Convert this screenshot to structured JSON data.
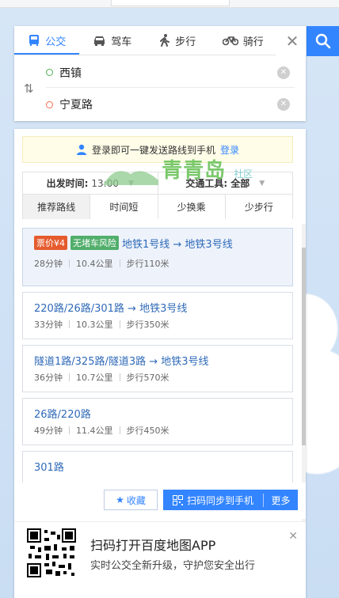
{
  "modes": [
    {
      "label": "公交",
      "icon": "bus-icon",
      "active": true
    },
    {
      "label": "驾车",
      "icon": "car-icon",
      "active": false
    },
    {
      "label": "步行",
      "icon": "walk-icon",
      "active": false
    },
    {
      "label": "骑行",
      "icon": "bike-icon",
      "active": false
    }
  ],
  "route": {
    "start": "西镇",
    "end": "宁夏路"
  },
  "login_tip": {
    "text": "登录即可一键发送路线到手机",
    "link": "登录"
  },
  "filters": {
    "depart_label": "出发时间:",
    "depart_value": "13:00",
    "transport_label": "交通工具:",
    "transport_value": "全部",
    "prefs": [
      "推荐路线",
      "时间短",
      "少换乘",
      "少步行"
    ]
  },
  "plans": [
    {
      "tags": [
        "票价¥4",
        "无堵车风险"
      ],
      "title": "地铁1号线 → 地铁3号线",
      "time": "28分钟",
      "distance": "10.4公里",
      "walk": "步行110米"
    },
    {
      "tags": [],
      "title": "220路/26路/301路 → 地铁3号线",
      "time": "33分钟",
      "distance": "10.3公里",
      "walk": "步行350米"
    },
    {
      "tags": [],
      "title": "隧道1路/325路/隧道3路 → 地铁3号线",
      "time": "36分钟",
      "distance": "10.7公里",
      "walk": "步行570米"
    },
    {
      "tags": [],
      "title": "26路/220路",
      "time": "49分钟",
      "distance": "11.4公里",
      "walk": "步行450米"
    },
    {
      "tags": [],
      "title": "301路",
      "time": "",
      "distance": "",
      "walk": ""
    }
  ],
  "actions": {
    "favorite": "收藏",
    "sync": "扫码同步到手机",
    "more": "更多"
  },
  "promo": {
    "title": "扫码打开百度地图APP",
    "subtitle": "实时公交全新升级，守护您安全出行"
  },
  "watermark": {
    "text": "青青岛",
    "sub": "社区"
  },
  "colors": {
    "accent": "#3385ff",
    "price_tag": "#e55b2e",
    "nojam_tag": "#51ae6b"
  }
}
